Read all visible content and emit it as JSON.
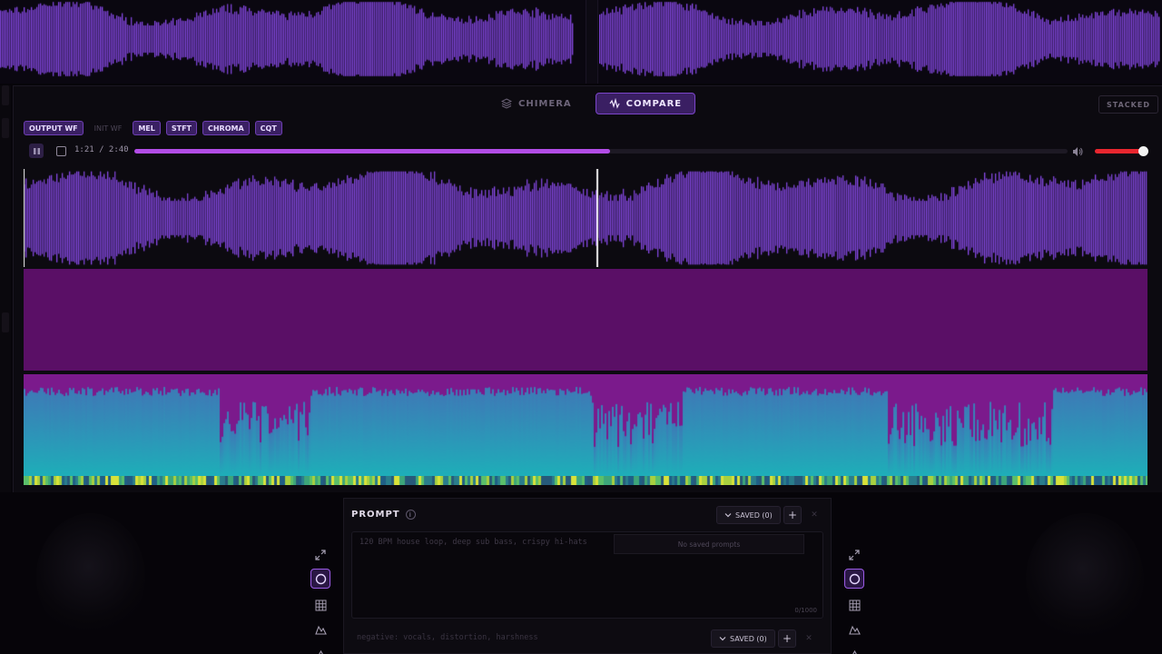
{
  "mode_tabs": [
    {
      "label": "CHIMERA",
      "icon": "layers-icon",
      "active": false
    },
    {
      "label": "COMPARE",
      "icon": "waveform-icon",
      "active": true
    }
  ],
  "layout_toggle_label": "STACKED",
  "vis_tabs": [
    {
      "label": "OUTPUT WF",
      "active": true
    },
    {
      "label": "INIT WF",
      "active": false
    },
    {
      "label": "MEL",
      "active": true
    },
    {
      "label": "STFT",
      "active": true
    },
    {
      "label": "CHROMA",
      "active": true
    },
    {
      "label": "CQT",
      "active": true
    }
  ],
  "transport": {
    "time": "1:21 / 2:40",
    "progress": 0.51,
    "volume": 0.92
  },
  "colors": {
    "accent": "#b24ce6",
    "waveform": "#8d4cf0",
    "mel": "#5a0f66",
    "stft_bg": "#7b1a8c",
    "stft_fg": "#1fa5b8",
    "volume": "#e8262f"
  },
  "prompt": {
    "title": "PROMPT",
    "saved_label": "SAVED (0)",
    "placeholder": "120 BPM house loop, deep sub bass, crispy hi-hats",
    "no_saved": "No saved prompts",
    "counter": "0/1000",
    "negative_placeholder": "negative: vocals, distortion, harshness",
    "negative_saved_label": "SAVED (0)"
  },
  "tools": [
    "circle-icon",
    "grid-icon",
    "mountain-icon",
    "triangle-icon"
  ]
}
